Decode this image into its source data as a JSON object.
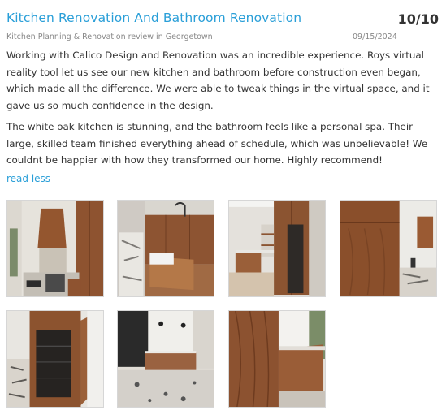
{
  "review": {
    "title": "Kitchen Renovation And Bathroom Renovation",
    "score": "10/10",
    "meta": "Kitchen Planning & Renovation review in Georgetown",
    "date": "09/15/2024",
    "paragraphs": [
      "Working with Calico Design and Renovation was an incredible experience. Roys virtual reality tool let us see our new kitchen and bathroom before construction even began, which made all the difference. We were able to tweak things in the virtual space, and it gave us so much confidence in the design.",
      "The white oak kitchen is stunning, and the bathroom feels like a personal spa. Their large, skilled team finished everything ahead of schedule, which was unbelievable! We couldnt be happier with how they transformed our home. Highly recommend!"
    ],
    "read_less": "read less"
  },
  "photos": [
    {
      "name": "kitchen-range-hood-photo"
    },
    {
      "name": "kitchen-appliance-drawer-photo"
    },
    {
      "name": "kitchen-pantry-cabinets-photo"
    },
    {
      "name": "walnut-panel-cabinet-photo"
    },
    {
      "name": "kitchen-built-in-cabinet-photo"
    },
    {
      "name": "bathroom-vanity-photo"
    },
    {
      "name": "walnut-island-photo"
    }
  ],
  "colors": {
    "accent": "#2a9fd8",
    "text": "#333333",
    "muted": "#888888",
    "walnut": "#8a4f2b"
  }
}
